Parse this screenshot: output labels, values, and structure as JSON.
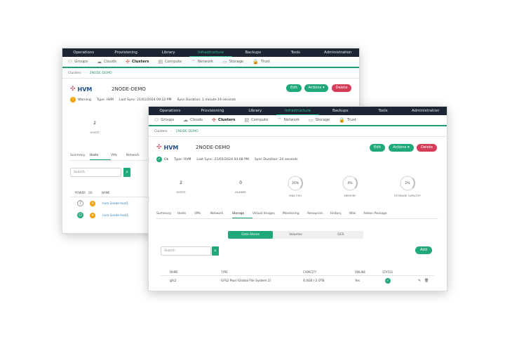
{
  "nav": [
    "Operations",
    "Provisioning",
    "Library",
    "Infrastructure",
    "Backups",
    "Tools",
    "Administration"
  ],
  "subnav": [
    {
      "label": "Groups",
      "icon": "groups-icon",
      "glyph": "⚇"
    },
    {
      "label": "Clouds",
      "icon": "cloud-icon",
      "glyph": "☁"
    },
    {
      "label": "Clusters",
      "icon": "clusters-icon",
      "glyph": "✣"
    },
    {
      "label": "Compute",
      "icon": "compute-icon",
      "glyph": "▤"
    },
    {
      "label": "Network",
      "icon": "network-icon",
      "glyph": "⌔"
    },
    {
      "label": "Storage",
      "icon": "storage-icon",
      "glyph": "▭"
    },
    {
      "label": "Trust",
      "icon": "trust-icon",
      "glyph": "🔒"
    }
  ],
  "back": {
    "crumb": {
      "root": "Clusters",
      "current": "2NODE-DEMO"
    },
    "logo": "HVM",
    "name": "2NODE-DEMO",
    "buttons": {
      "edit": "Edit",
      "actions": "Actions ▾",
      "delete": "Delete"
    },
    "status": "Warning",
    "type": "Type: HVM",
    "last_sync": "Last Sync: 21/01/2024 09:12 PM",
    "sync_duration": "Sync Duration: 1 minute 19 seconds",
    "hosts_value": "2",
    "hosts_label": "HOSTS",
    "tabs": [
      "Summary",
      "Hosts",
      "VMs",
      "Network"
    ],
    "search_placeholder": "Search",
    "columns": [
      "POWER",
      "OS",
      "NAME"
    ],
    "rows": [
      {
        "name": "hvm-2node-host1"
      },
      {
        "name": "hvm-2node-host2"
      }
    ]
  },
  "front": {
    "crumb": {
      "root": "Clusters",
      "current": "2NODE-DEMO"
    },
    "logo": "HVM",
    "name": "2NODE-DEMO",
    "buttons": {
      "edit": "Edit",
      "actions": "Actions ▾",
      "delete": "Delete"
    },
    "status": "Ok",
    "type": "Type: HVM",
    "last_sync": "Last Sync: 21/01/2024 04:08 PM",
    "sync_duration": "Sync Duration: 24 seconds",
    "metrics": [
      {
        "value": "2",
        "label": "HOSTS"
      },
      {
        "value": "0",
        "label": "ALARMS"
      }
    ],
    "gauges": [
      {
        "value": "35%",
        "label": "MAX CPU"
      },
      {
        "value": "4%",
        "label": "MEMORY"
      },
      {
        "value": "2%",
        "label": "STORAGE CAPACITY"
      }
    ],
    "tabs": [
      "Summary",
      "Hosts",
      "VMs",
      "Network",
      "Storage",
      "Virtual Images",
      "Monitoring",
      "Resources",
      "History",
      "Wiki",
      "Addon Package"
    ],
    "segments": [
      "Data Stores",
      "Volumes",
      "GCS"
    ],
    "search_placeholder": "Search",
    "add": "Add",
    "columns": [
      "NAME",
      "TYPE",
      "CAPACITY",
      "ONLINE",
      "STATUS"
    ],
    "rows": [
      {
        "name": "gfs2",
        "type": "GFS2 Pool (Global File System 2)",
        "capacity": "4.0GB / 2.0TB",
        "online": "Yes"
      }
    ]
  }
}
